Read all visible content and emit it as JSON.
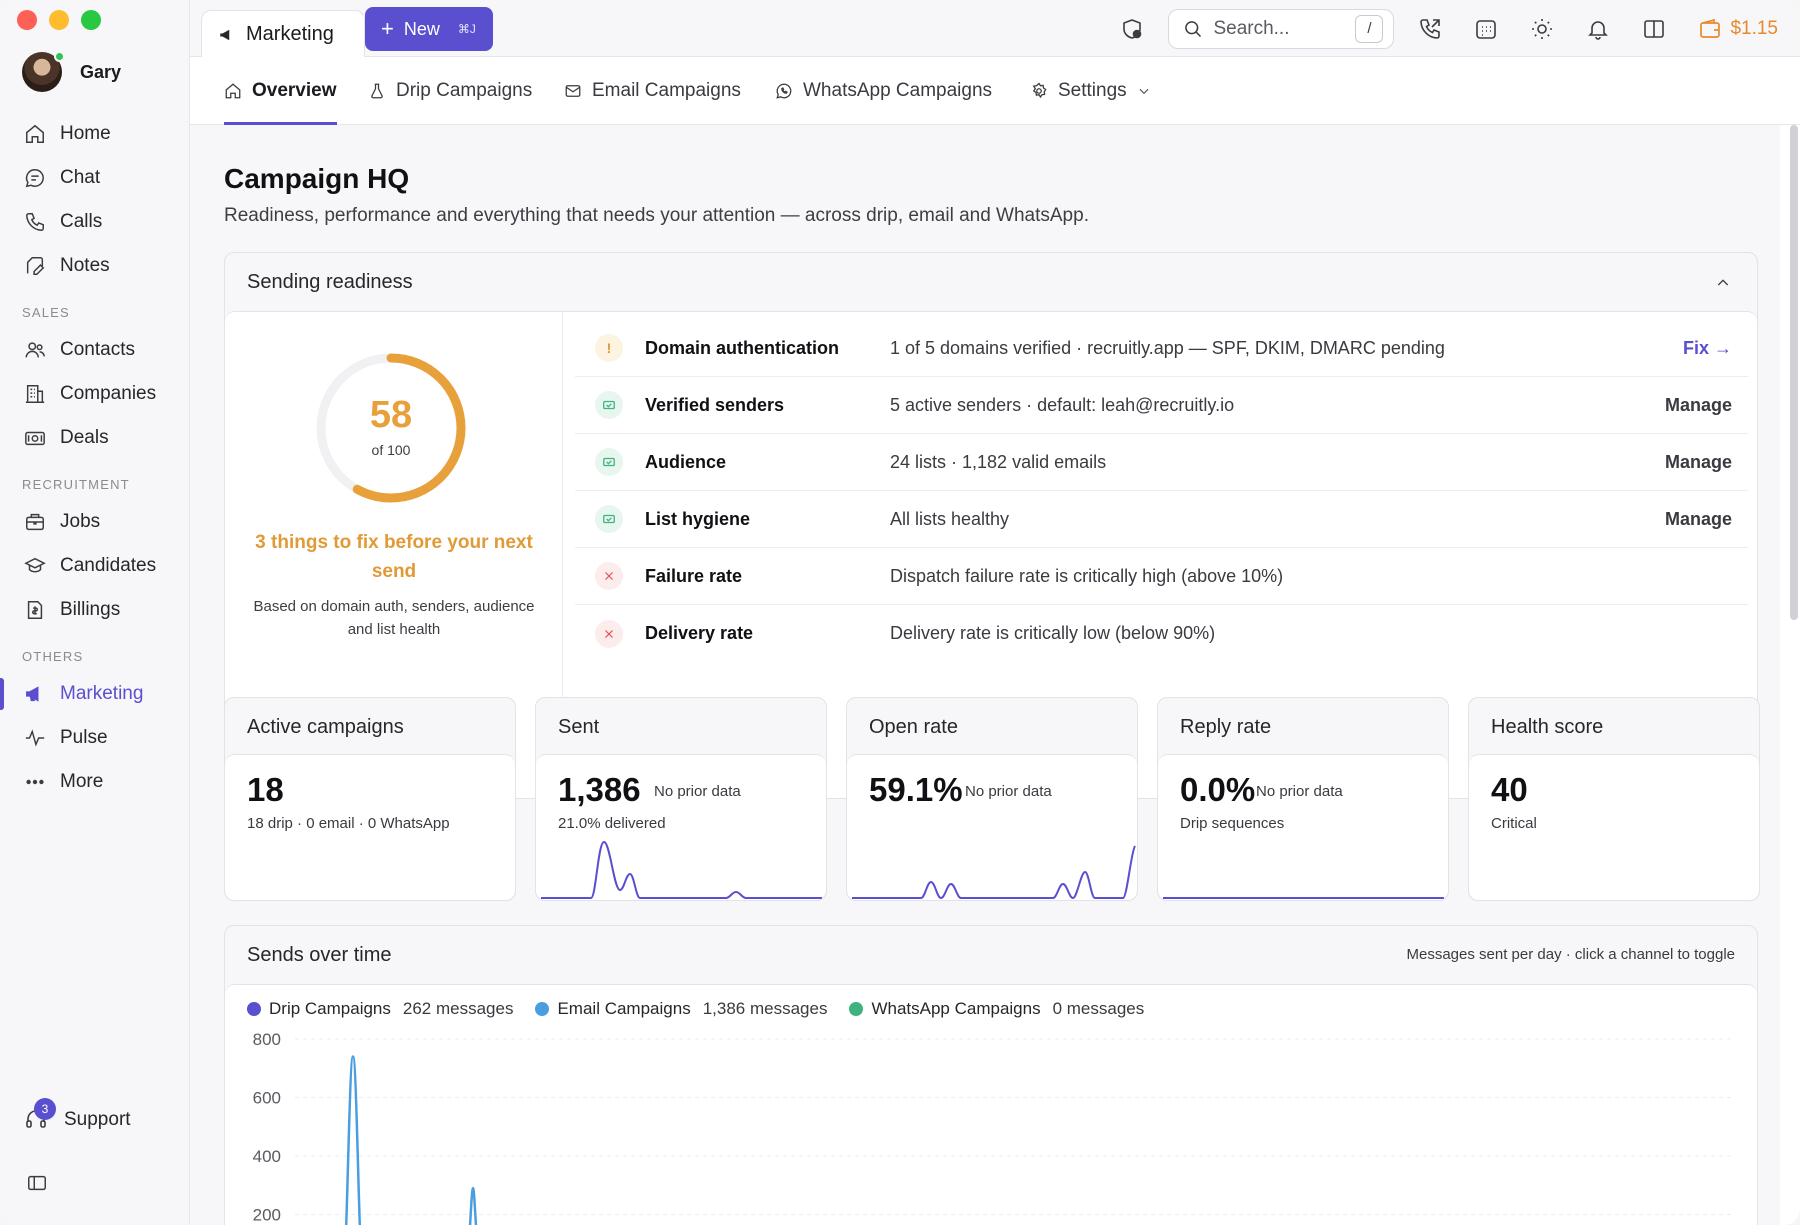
{
  "sidebar": {
    "user_name": "Gary",
    "items": [
      {
        "label": "Home",
        "icon": "home-icon"
      },
      {
        "label": "Chat",
        "icon": "chat-icon"
      },
      {
        "label": "Calls",
        "icon": "phone-icon"
      },
      {
        "label": "Notes",
        "icon": "note-icon"
      }
    ],
    "sections": {
      "sales": "SALES",
      "recruitment": "RECRUITMENT",
      "others": "OTHERS"
    },
    "sales_items": [
      {
        "label": "Contacts",
        "icon": "contacts-icon"
      },
      {
        "label": "Companies",
        "icon": "building-icon"
      },
      {
        "label": "Deals",
        "icon": "deals-icon"
      }
    ],
    "recruitment_items": [
      {
        "label": "Jobs",
        "icon": "briefcase-icon"
      },
      {
        "label": "Candidates",
        "icon": "graduation-cap-icon"
      },
      {
        "label": "Billings",
        "icon": "billing-icon"
      }
    ],
    "others_items": [
      {
        "label": "Marketing",
        "icon": "megaphone-icon",
        "active": true
      },
      {
        "label": "Pulse",
        "icon": "pulse-icon"
      },
      {
        "label": "More",
        "icon": "more-icon"
      }
    ],
    "support_label": "Support",
    "support_badge": "3"
  },
  "topbar": {
    "tab_label": "Marketing",
    "new_label": "New",
    "new_shortcut": "⌘J",
    "search_placeholder": "Search...",
    "search_shortcut": "/",
    "wallet_amount": "$1.15"
  },
  "subnav": {
    "tabs": [
      {
        "label": "Overview",
        "icon": "home-icon",
        "active": true
      },
      {
        "label": "Drip Campaigns",
        "icon": "drip-icon"
      },
      {
        "label": "Email Campaigns",
        "icon": "mail-icon"
      },
      {
        "label": "WhatsApp Campaigns",
        "icon": "whatsapp-icon"
      },
      {
        "label": "Settings",
        "icon": "gear-icon"
      }
    ]
  },
  "page": {
    "title": "Campaign HQ",
    "subtitle": "Readiness, performance and everything that needs your attention — across drip, email and WhatsApp."
  },
  "readiness": {
    "title": "Sending readiness",
    "score": 58,
    "score_of": "of 100",
    "score_fraction": 0.58,
    "fix_headline": "3 things to fix before your next send",
    "fix_note": "Based on domain auth, senders, audience and list health",
    "checks": [
      {
        "status": "warn",
        "label": "Domain authentication",
        "detail": "1 of 5 domains verified · recruitly.app — SPF, DKIM, DMARC pending",
        "action": "Fix →"
      },
      {
        "status": "ok",
        "label": "Verified senders",
        "detail": "5 active senders · default: leah@recruitly.io",
        "action": "Manage"
      },
      {
        "status": "ok",
        "label": "Audience",
        "detail": "24 lists · 1,182 valid emails",
        "action": "Manage"
      },
      {
        "status": "ok",
        "label": "List hygiene",
        "detail": "All lists healthy",
        "action": "Manage"
      },
      {
        "status": "bad",
        "label": "Failure rate",
        "detail": "Dispatch failure rate is critically high (above 10%)",
        "action": ""
      },
      {
        "status": "bad",
        "label": "Delivery rate",
        "detail": "Delivery rate is critically low (below 90%)",
        "action": ""
      }
    ]
  },
  "stats": [
    {
      "title": "Active campaigns",
      "value": "18",
      "note": "",
      "sub": "18 drip · 0 email · 0 WhatsApp"
    },
    {
      "title": "Sent",
      "value": "1,386",
      "note": "No prior data",
      "sub": "21.0% delivered"
    },
    {
      "title": "Open rate",
      "value": "59.1%",
      "note": "No prior data",
      "sub": ""
    },
    {
      "title": "Reply rate",
      "value": "0.0%",
      "note": "No prior data",
      "sub": "Drip sequences"
    },
    {
      "title": "Health score",
      "value": "40",
      "note": "",
      "sub": "Critical"
    }
  ],
  "sends": {
    "title": "Sends over time",
    "hint": "Messages sent per day · click a channel to toggle",
    "legend": [
      {
        "name": "Drip Campaigns",
        "count": "262 messages",
        "color": "#5a4fcf"
      },
      {
        "name": "Email Campaigns",
        "count": "1,386 messages",
        "color": "#4a9ee0"
      },
      {
        "name": "WhatsApp Campaigns",
        "count": "0 messages",
        "color": "#3fb27f"
      }
    ]
  },
  "colors": {
    "accent": "#5a4fcf",
    "warning": "#e8a13a",
    "success": "#3fb27f",
    "danger": "#e05252"
  },
  "chart_data": {
    "type": "line",
    "title": "Sends over time",
    "ylim": [
      0,
      800
    ],
    "yticks": [
      800,
      600,
      400,
      200
    ],
    "series": [
      {
        "name": "Email Campaigns",
        "color": "#4a9ee0",
        "values": [
          0,
          740,
          0,
          0,
          0,
          0,
          0,
          290,
          0
        ]
      }
    ]
  }
}
